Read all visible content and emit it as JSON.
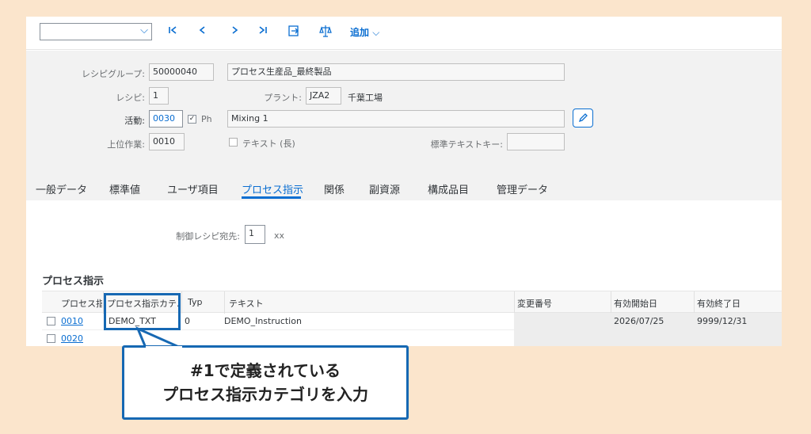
{
  "toolbar": {
    "select_value": "",
    "add_label": "追加"
  },
  "header": {
    "recipe_group_label": "レシピグループ:",
    "recipe_group_value": "50000040",
    "recipe_group_desc": "プロセス生産品_最終製品",
    "recipe_label": "レシピ:",
    "recipe_value": "1",
    "plant_label": "プラント:",
    "plant_value": "JZA2",
    "plant_name": "千葉工場",
    "activity_label": "活動:",
    "activity_value": "0030",
    "ph_label": "Ph",
    "activity_desc": "Mixing 1",
    "parent_op_label": "上位作業:",
    "parent_op_value": "0010",
    "text_long_label": "テキスト (長)",
    "std_text_key_label": "標準テキストキー:",
    "std_text_key_value": ""
  },
  "tabs": [
    {
      "label": "一般データ"
    },
    {
      "label": "標準値"
    },
    {
      "label": "ユーザ項目"
    },
    {
      "label": "プロセス指示"
    },
    {
      "label": "関係"
    },
    {
      "label": "副資源"
    },
    {
      "label": "構成品目"
    },
    {
      "label": "管理データ"
    }
  ],
  "content": {
    "control_recipe_label": "制御レシピ宛先:",
    "control_recipe_value": "1",
    "control_recipe_suffix": "xx",
    "section_title": "プロセス指示"
  },
  "table": {
    "columns": [
      "プロセス指",
      "プロセス指示カテ...",
      "Typ",
      "テキスト",
      "変更番号",
      "有効開始日",
      "有効終了日"
    ],
    "rows": [
      {
        "no": "0010",
        "category": "DEMO_TXT",
        "typ": "0",
        "text": "DEMO_Instruction",
        "change_no": "",
        "valid_from": "2026/07/25",
        "valid_to": "9999/12/31"
      },
      {
        "no": "0020",
        "category": "",
        "typ": "",
        "text": "",
        "change_no": "",
        "valid_from": "",
        "valid_to": ""
      }
    ]
  },
  "callout": {
    "line1": "#1で定義されている",
    "line2": "プロセス指示カテゴリを入力"
  },
  "colors": {
    "accent": "#0a6ed1",
    "callout_border": "#1668b3",
    "background": "#fbe5cc"
  }
}
